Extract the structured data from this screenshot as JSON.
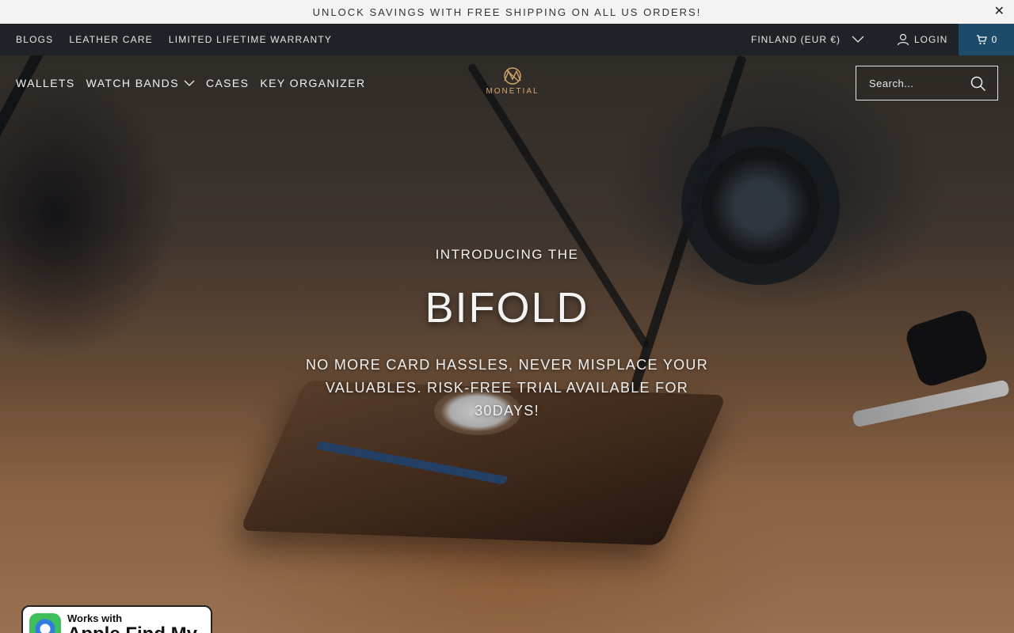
{
  "announcement": {
    "text": "UNLOCK SAVINGS WITH FREE SHIPPING ON ALL US ORDERS!",
    "close_icon": "close-icon"
  },
  "topbar": {
    "links": [
      "BLOGS",
      "LEATHER CARE",
      "LIMITED LIFETIME WARRANTY"
    ],
    "currency": "FINLAND (EUR €)",
    "login": "LOGIN",
    "cart_count": "0"
  },
  "nav": {
    "items": [
      "WALLETS",
      "WATCH BANDS",
      "CASES",
      "KEY ORGANIZER"
    ],
    "logo_text": "MONETIAL",
    "search_placeholder": "Search..."
  },
  "hero": {
    "eyebrow": "INTRODUCING THE",
    "headline": "BIFOLD",
    "subtitle": "NO MORE CARD HASSLES, NEVER MISPLACE YOUR VALUABLES. RISK-FREE TRIAL AVAILABLE FOR 30DAYS!"
  },
  "badge": {
    "small": "Works with",
    "big": "Apple Find My"
  },
  "colors": {
    "topbar_bg": "#1f2328",
    "cart_bg": "#1c4a6b",
    "logo_gold": "#d3a76a"
  }
}
